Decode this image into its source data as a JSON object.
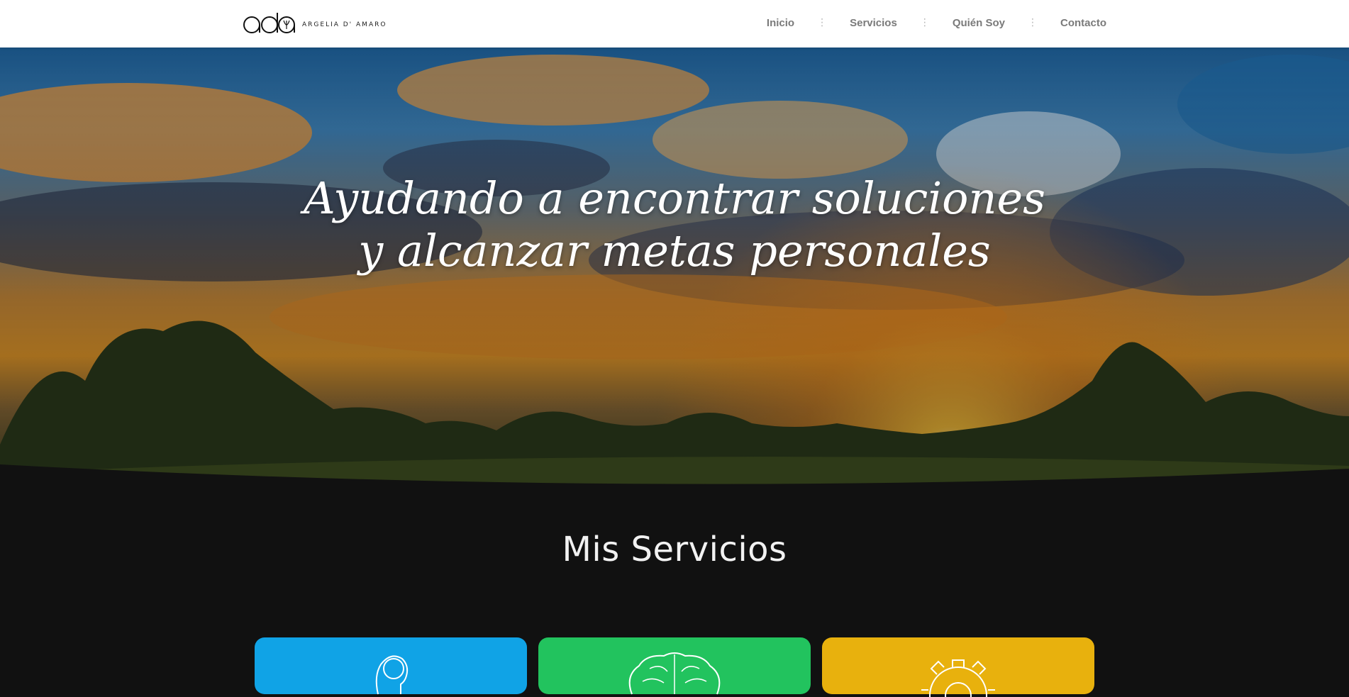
{
  "header": {
    "logo_monogram": "ada",
    "logo_text": "ARGELIA D' AMARO",
    "nav": [
      {
        "label": "Inicio"
      },
      {
        "label": "Servicios"
      },
      {
        "label": "Quién Soy"
      },
      {
        "label": "Contacto"
      }
    ],
    "separator": "⋮"
  },
  "hero": {
    "line1": "Ayudando a encontrar soluciones",
    "line2": "y alcanzar metas personales"
  },
  "services": {
    "title": "Mis Servicios",
    "cards": [
      {
        "icon": "head-profile-icon",
        "color": "#10a3e6"
      },
      {
        "icon": "brain-icon",
        "color": "#22c35e"
      },
      {
        "icon": "gear-icon",
        "color": "#e8b10d"
      }
    ]
  },
  "colors": {
    "header_bg": "#ffffff",
    "nav_text": "#7a7a7a",
    "page_bg": "#111111",
    "hero_text": "#ffffff"
  }
}
